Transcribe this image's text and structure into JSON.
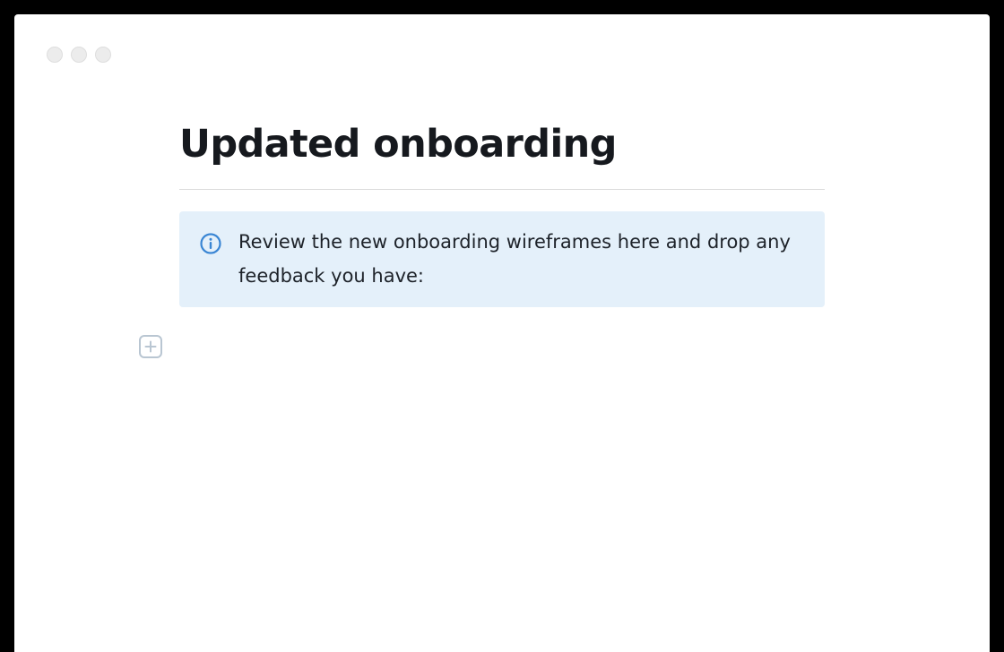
{
  "window": {
    "controls": [
      "close",
      "minimize",
      "zoom"
    ]
  },
  "document": {
    "title": "Updated onboarding",
    "callout": {
      "icon": "info-icon",
      "text": "Review the new onboarding wireframes here and drop any feedback you have:"
    },
    "add_block_icon": "plus-square-icon"
  },
  "colors": {
    "callout_background": "#e4f0fa",
    "info_icon": "#3a86d4",
    "title_text": "#16191e",
    "add_icon": "#b9c6d2"
  }
}
